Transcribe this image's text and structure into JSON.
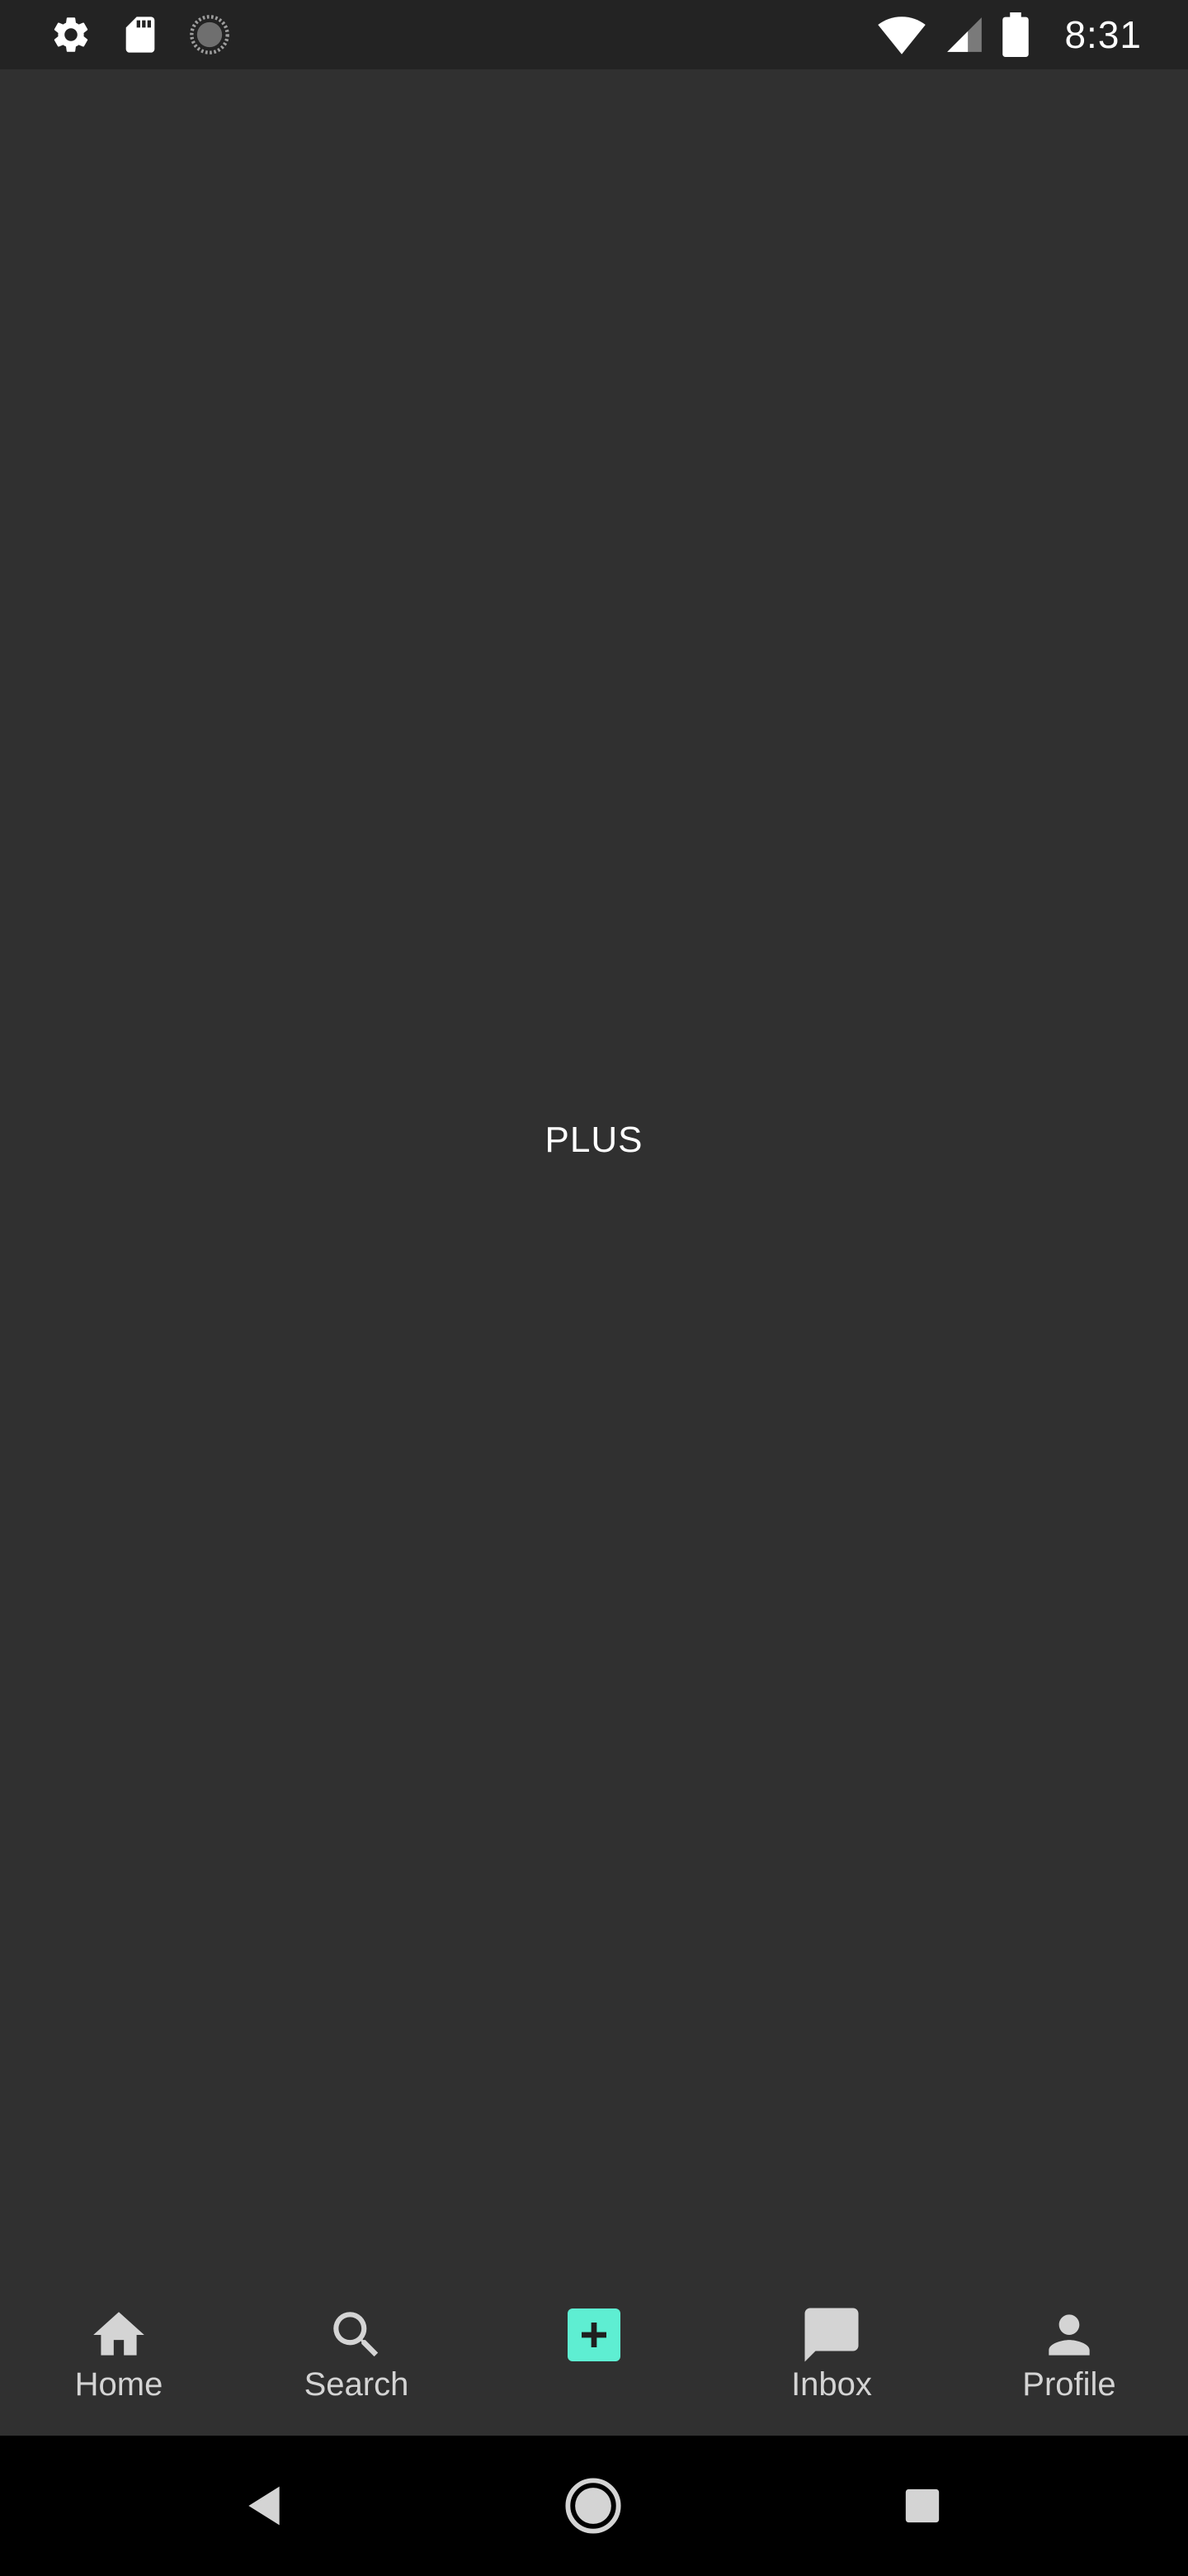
{
  "status_bar": {
    "time": "8:31",
    "left_icons": [
      "gear-icon",
      "sd-card-icon",
      "sync-circle-icon"
    ],
    "right_icons": [
      "wifi-icon",
      "cell-signal-icon",
      "battery-icon"
    ]
  },
  "main": {
    "center_text": "PLUS"
  },
  "bottom_nav": {
    "items": [
      {
        "label": "Home",
        "icon": "home-icon"
      },
      {
        "label": "Search",
        "icon": "search-icon"
      },
      {
        "label": "",
        "icon": "plus-icon"
      },
      {
        "label": "Inbox",
        "icon": "chat-bubble-icon"
      },
      {
        "label": "Profile",
        "icon": "person-icon"
      }
    ]
  },
  "system_nav": {
    "buttons": [
      "back-icon",
      "home-circle-icon",
      "recents-square-icon"
    ]
  },
  "colors": {
    "background": "#303030",
    "status_bar": "#232323",
    "accent": "#5eeed2",
    "nav_icon": "#d4d4d4",
    "system_nav": "#000000"
  }
}
